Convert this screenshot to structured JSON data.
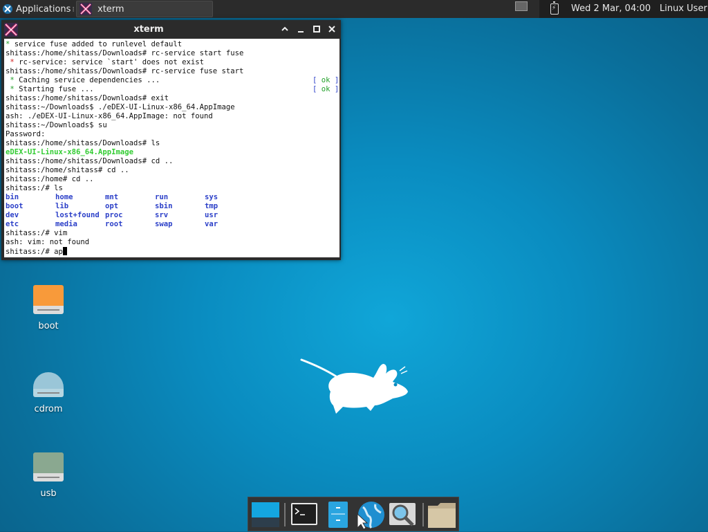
{
  "panel": {
    "applications_label": "Applications",
    "task_title": "xterm",
    "clock": "Wed  2 Mar, 04:00",
    "user": "Linux User"
  },
  "window": {
    "title": "xterm",
    "buttons": {
      "shade": "^",
      "minimize": "_",
      "maximize": "□",
      "close": "✕"
    }
  },
  "terminal": {
    "lines": [
      {
        "pre": "",
        "mark": "*",
        "text": " service fuse added to runlevel default",
        "mark_color": "green"
      },
      {
        "text": "shitass:/home/shitass/Downloads# rc-service start fuse"
      },
      {
        "pre": " ",
        "mark": "*",
        "text": " rc-service: service `start' does not exist",
        "mark_color": "red"
      },
      {
        "text": "shitass:/home/shitass/Downloads# rc-service fuse start"
      },
      {
        "pre": " ",
        "mark": "*",
        "text": " Caching service dependencies ...",
        "mark_color": "green",
        "status": "ok"
      },
      {
        "pre": " ",
        "mark": "*",
        "text": " Starting fuse ...",
        "mark_color": "green",
        "status": "ok"
      },
      {
        "text": "shitass:/home/shitass/Downloads# exit"
      },
      {
        "text": "shitass:~/Downloads$ ./eDEX-UI-Linux-x86_64.AppImage"
      },
      {
        "text": "ash: ./eDEX-UI-Linux-x86_64.AppImage: not found"
      },
      {
        "text": "shitass:~/Downloads$ su"
      },
      {
        "text": "Password:"
      },
      {
        "text": "shitass:/home/shitass/Downloads# ls"
      },
      {
        "text": "eDEX-UI-Linux-x86_64.AppImage",
        "style": "green-bold"
      },
      {
        "text": "shitass:/home/shitass/Downloads# cd .."
      },
      {
        "text": "shitass:/home/shitass# cd .."
      },
      {
        "text": "shitass:/home# cd .."
      },
      {
        "text": "shitass:/# ls"
      }
    ],
    "ok_text": " ok ",
    "ls_columns": [
      [
        "bin",
        "boot",
        "dev",
        "etc"
      ],
      [
        "home",
        "lib",
        "lost+found",
        "media"
      ],
      [
        "mnt",
        "opt",
        "proc",
        "root"
      ],
      [
        "run",
        "sbin",
        "srv",
        "swap"
      ],
      [
        "sys",
        "tmp",
        "usr",
        "var"
      ]
    ],
    "after_lines": [
      "shitass:/# vim",
      "ash: vim: not found"
    ],
    "prompt": "shitass:/# ",
    "input": "ap"
  },
  "desktop_icons": [
    {
      "label": "boot",
      "color": "#f89a3a"
    },
    {
      "label": "cdrom",
      "color": "#9ac6d8"
    },
    {
      "label": "usb",
      "color": "#8aa890"
    }
  ],
  "dock_items": [
    {
      "name": "show-desktop"
    },
    {
      "name": "terminal"
    },
    {
      "name": "file-manager"
    },
    {
      "name": "web-browser"
    },
    {
      "name": "app-finder"
    },
    {
      "name": "home-folder"
    }
  ]
}
